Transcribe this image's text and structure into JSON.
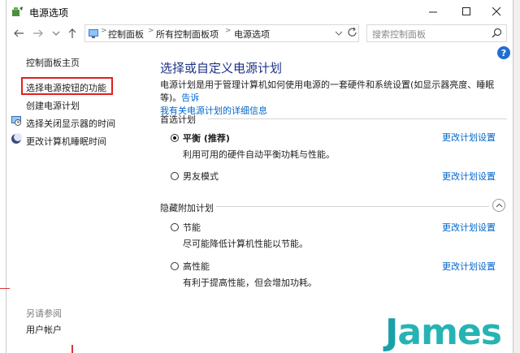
{
  "window": {
    "title": "电源选项",
    "controls": {
      "minimize": "minimize",
      "maximize": "maximize",
      "close": "close"
    }
  },
  "addressbar": {
    "crumbs": [
      "控制面板",
      "所有控制面板项",
      "电源选项"
    ],
    "search_placeholder": "搜索控制面板"
  },
  "sidebar": {
    "home": "控制面板主页",
    "items": [
      {
        "label": "选择电源按钮的功能",
        "highlighted": true
      },
      {
        "label": "创建电源计划"
      },
      {
        "label": "选择关闭显示器的时间",
        "icon": "monitor-clock-icon"
      },
      {
        "label": "更改计算机睡眠时间",
        "icon": "moon-icon"
      }
    ],
    "see_also": "另请参阅",
    "user_accounts": "用户帐户"
  },
  "main": {
    "heading": "选择或自定义电源计划",
    "description_text": "电源计划是用于管理计算机如何使用电源的一套硬件和系统设置(如显示器亮度、睡眠等)。",
    "description_link_1": "告诉",
    "description_link_2": "我有关电源计划的详细信息",
    "preferred_title": "首选计划",
    "hidden_title": "隐藏附加计划",
    "plans_preferred": [
      {
        "name": "平衡 (推荐)",
        "desc": "利用可用的硬件自动平衡功耗与性能。",
        "selected": true,
        "link": "更改计划设置"
      },
      {
        "name": "男友模式",
        "desc": "",
        "selected": false,
        "link": "更改计划设置"
      }
    ],
    "plans_hidden": [
      {
        "name": "节能",
        "desc": "尽可能降低计算机性能以节能。",
        "selected": false,
        "link": "更改计划设置"
      },
      {
        "name": "高性能",
        "desc": "有利于提高性能，但会增加功耗。",
        "selected": false,
        "link": "更改计划设置"
      }
    ]
  },
  "watermark": {
    "first": "J",
    "rest": "ames"
  },
  "colors": {
    "accent": "#0066cc",
    "heading": "#1e3287",
    "highlight_border": "#e02020",
    "watermark": "#27b3b3"
  }
}
